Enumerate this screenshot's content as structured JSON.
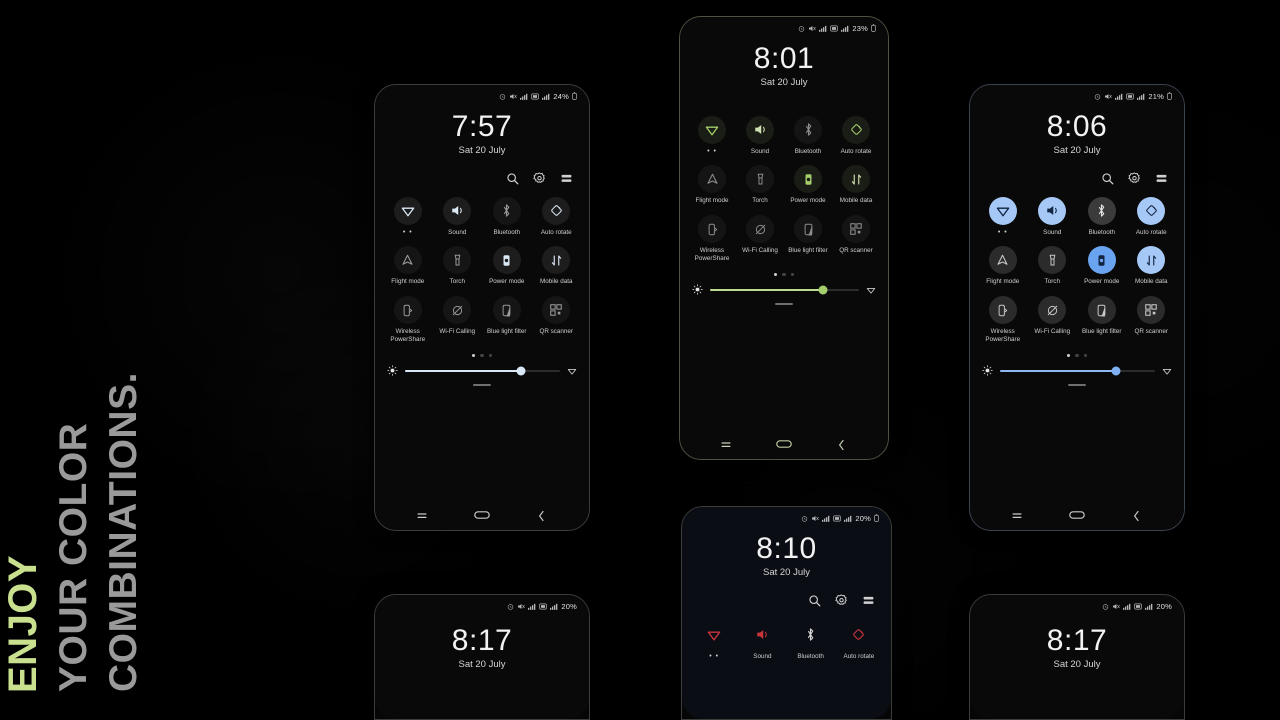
{
  "caption": {
    "line1": "ENJOY",
    "line2": "YOUR COLOR",
    "line3": "COMBINATIONS.",
    "accent_color": "#c9e08f",
    "secondary_color": "#9a9a9a"
  },
  "tile_labels": {
    "wifi": "",
    "wifi_dots": "• •",
    "sound": "Sound",
    "bluetooth": "Bluetooth",
    "auto_rotate": "Auto rotate",
    "flight_mode": "Flight mode",
    "torch": "Torch",
    "power_mode": "Power mode",
    "mobile_data": "Mobile data",
    "wireless_powershare": "Wireless PowerShare",
    "wifi_calling": "Wi-Fi Calling",
    "blue_light_filter": "Blue light filter",
    "qr_scanner": "QR scanner"
  },
  "phones": [
    {
      "id": "phone-left-top",
      "theme": "white",
      "accent": "#cfe3f5",
      "time": "7:57",
      "date": "Sat 20 July",
      "battery": "24%",
      "brightness_percent": 75,
      "page_dots": 3,
      "active_page": 0,
      "active_tiles": [
        "wifi",
        "sound",
        "auto_rotate",
        "power_mode",
        "mobile_data"
      ]
    },
    {
      "id": "phone-center-top",
      "theme": "green",
      "accent": "#a4cd6b",
      "time": "8:01",
      "date": "Sat 20 July",
      "battery": "23%",
      "brightness_percent": 76,
      "page_dots": 3,
      "active_page": 0,
      "active_tiles": [
        "wifi",
        "sound",
        "auto_rotate",
        "power_mode",
        "mobile_data"
      ]
    },
    {
      "id": "phone-right-top",
      "theme": "blue",
      "accent": "#7fb0f2",
      "time": "8:06",
      "date": "Sat 20 July",
      "battery": "21%",
      "brightness_percent": 75,
      "page_dots": 3,
      "active_page": 0,
      "active_tiles": [
        "wifi",
        "sound",
        "auto_rotate",
        "power_mode",
        "mobile_data"
      ]
    },
    {
      "id": "phone-center-bottom",
      "theme": "red",
      "accent": "#c7343c",
      "time": "8:10",
      "date": "Sat 20 July",
      "battery": "20%",
      "active_tiles": [
        "wifi",
        "sound",
        "auto_rotate"
      ]
    },
    {
      "id": "phone-left-bottom",
      "theme": "white",
      "accent": "#e8e8e8",
      "time": "8:17",
      "date": "Sat 20 July",
      "battery": "20%"
    },
    {
      "id": "phone-right-bottom",
      "theme": "white",
      "accent": "#e8e8e8",
      "time": "8:17",
      "date": "Sat 20 July",
      "battery": "20%"
    }
  ],
  "icons": {
    "search": "search-icon",
    "settings": "gear-icon",
    "list": "list-icon",
    "brightness": "brightness-icon",
    "wifi_small": "wifi-icon",
    "nav_recents": "recents-icon",
    "nav_home": "home-pill-icon",
    "nav_back": "back-chevron-icon",
    "status_alarm": "alarm-icon",
    "status_mute": "mute-icon",
    "status_signal": "signal-bars-icon",
    "status_battery": "battery-icon"
  }
}
